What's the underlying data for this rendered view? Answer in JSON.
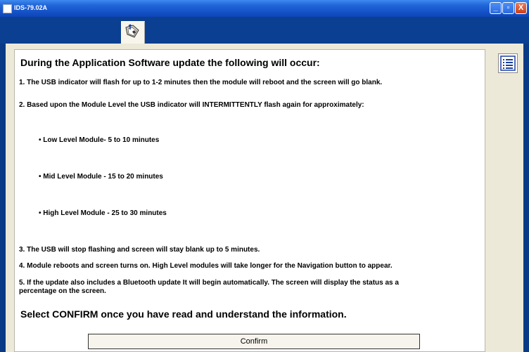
{
  "window": {
    "title": "IDS-79.02A",
    "minimize_label": "_",
    "maximize_label": "▫",
    "close_label": "X"
  },
  "colors": {
    "titlebar": "#2266D8",
    "toolbar": "#0B3F91",
    "panel_bg": "#EDE9D9",
    "accent": "#1A3FA0"
  },
  "toolbar": {
    "tab_icon": "navigation-hand-icon"
  },
  "content": {
    "heading": "During the Application Software update the following will occur:",
    "step1": "1. The USB indicator will flash for up to 1-2 minutes then the module will reboot and the screen will go blank.",
    "step2": "2. Based upon the Module Level the USB indicator will INTERMITTENTLY flash again for approximately:",
    "bullets": [
      "• Low Level Module- 5 to 10 minutes",
      "• Mid Level Module - 15 to 20 minutes",
      "• High Level Module - 25 to 30 minutes"
    ],
    "step3": "3. The USB will stop flashing and screen will stay blank up to 5 minutes.",
    "step4": "4. Module reboots and screen turns on. High Level modules will take longer for the Navigation button to appear.",
    "step5_line1": "5. If the update also includes a Bluetooth update It will begin automatically. The screen will display the status as a",
    "step5_line2": "percentage on the screen.",
    "footer": "Select CONFIRM once you have read and understand the information.",
    "confirm_label": "Confirm"
  },
  "side": {
    "menu_icon": "list-menu-icon"
  }
}
